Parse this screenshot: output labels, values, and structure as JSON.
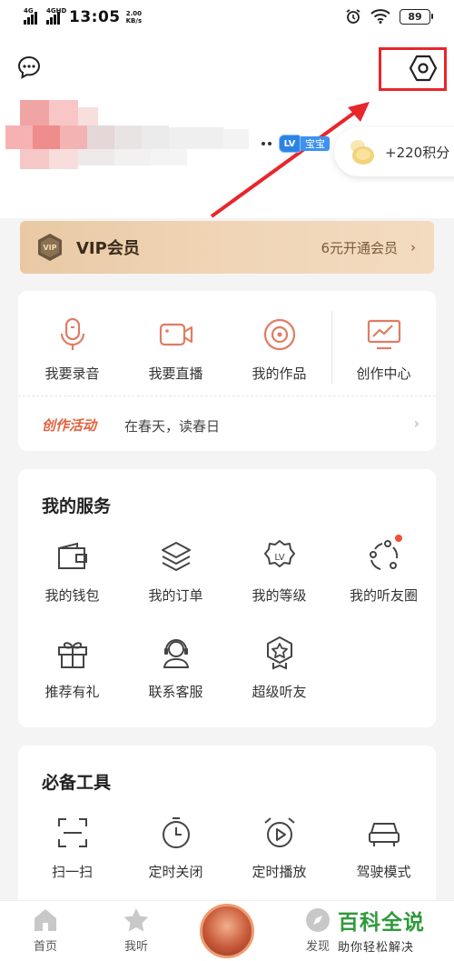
{
  "status_bar": {
    "net1": "4G",
    "net2": "4GHD",
    "time": "13:05",
    "speed_value": "2.00",
    "speed_unit": "KB/s",
    "battery": "89"
  },
  "profile": {
    "level_badge": "LV",
    "level_text": "宝宝",
    "points": "+220积分"
  },
  "vip": {
    "title": "VIP会员",
    "action": "6元开通会员",
    "icon_text": "VIP"
  },
  "create": {
    "items": [
      {
        "label": "我要录音",
        "icon": "microphone-icon"
      },
      {
        "label": "我要直播",
        "icon": "video-camera-icon"
      },
      {
        "label": "我的作品",
        "icon": "disc-icon"
      },
      {
        "label": "创作中心",
        "icon": "monitor-chart-icon"
      }
    ],
    "activity_tag": "创作活动",
    "activity_text": "在春天，读春日"
  },
  "services": {
    "title": "我的服务",
    "items": [
      {
        "label": "我的钱包",
        "icon": "wallet-icon"
      },
      {
        "label": "我的订单",
        "icon": "layers-icon"
      },
      {
        "label": "我的等级",
        "icon": "level-badge-icon"
      },
      {
        "label": "我的听友圈",
        "icon": "friends-circle-icon"
      },
      {
        "label": "推荐有礼",
        "icon": "gift-icon"
      },
      {
        "label": "联系客服",
        "icon": "customer-service-icon"
      },
      {
        "label": "超级听友",
        "icon": "star-badge-icon"
      }
    ]
  },
  "tools": {
    "title": "必备工具",
    "items": [
      {
        "label": "扫一扫",
        "icon": "scan-icon"
      },
      {
        "label": "定时关闭",
        "icon": "timer-icon"
      },
      {
        "label": "定时播放",
        "icon": "alarm-play-icon"
      },
      {
        "label": "驾驶模式",
        "icon": "car-icon"
      }
    ]
  },
  "bottom_nav": {
    "items": [
      {
        "label": "首页",
        "icon": "home-icon"
      },
      {
        "label": "我听",
        "icon": "star-icon"
      },
      {
        "label": "发现",
        "icon": "compass-icon"
      }
    ]
  },
  "watermark": {
    "title": "百科全说",
    "subtitle": "助你轻松解决"
  },
  "colors": {
    "accent_red": "#e8262c",
    "activity_orange": "#e0623e",
    "vip_gold": "#e9c9a4",
    "level_blue": "#2c83e6",
    "watermark_green": "#2f9a3b"
  }
}
